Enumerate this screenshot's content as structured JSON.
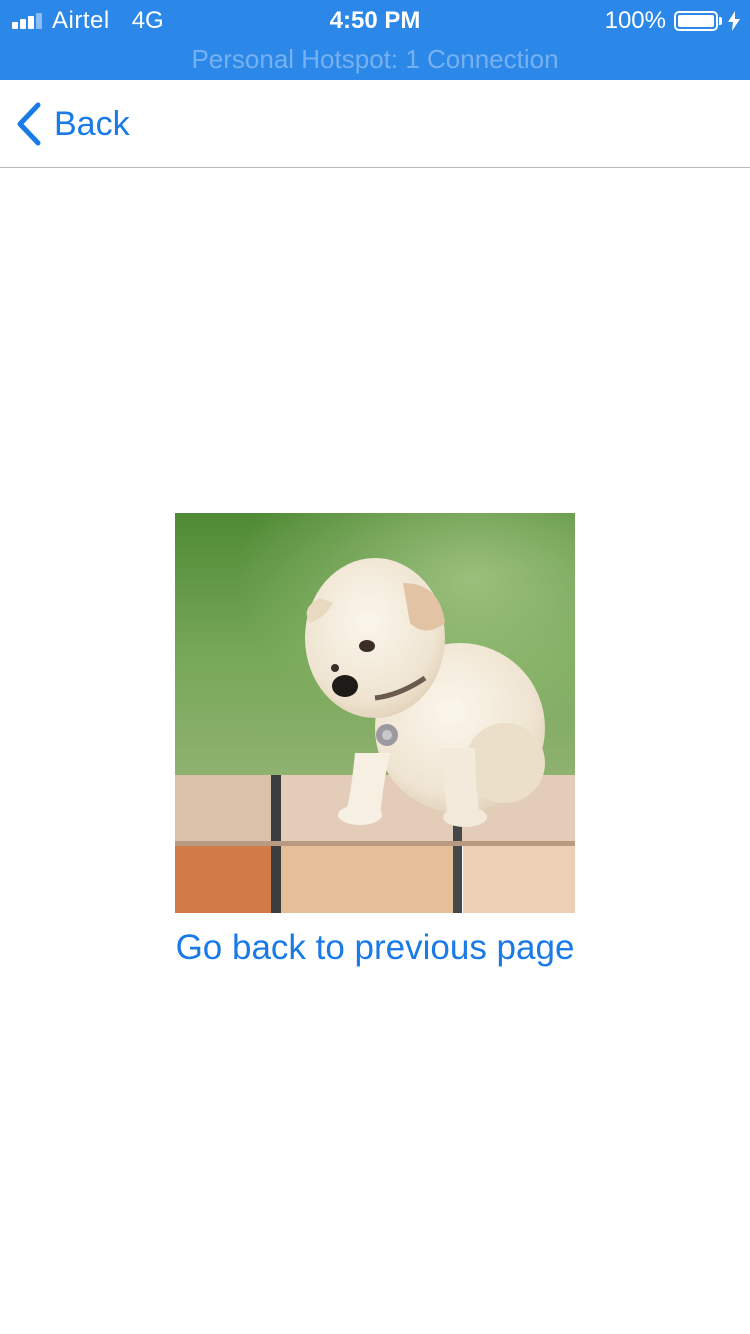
{
  "status_bar": {
    "carrier": "Airtel",
    "network": "4G",
    "time": "4:50 PM",
    "battery": "100%",
    "hotspot": "Personal Hotspot: 1 Connection",
    "signal_bars": 4,
    "signal_active": 3,
    "background_color": "#2b87e8"
  },
  "nav": {
    "back_label": "Back",
    "back_icon": "chevron-left-icon",
    "tint_color": "#1a7ae6"
  },
  "main": {
    "image_subject": "white-puppy",
    "link_label": "Go back to previous page"
  }
}
